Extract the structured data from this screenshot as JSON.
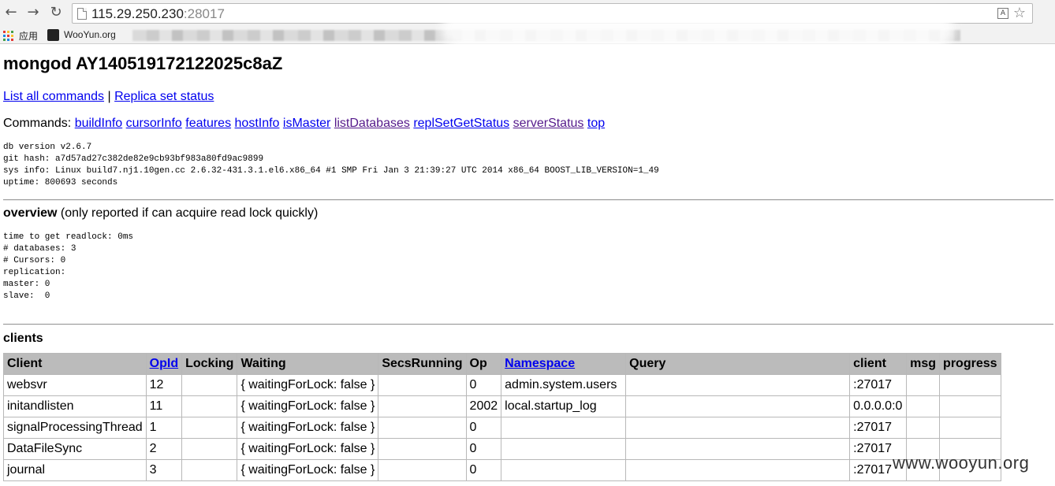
{
  "browser": {
    "url_host": "115.29.250.230",
    "url_port": ":28017",
    "bookmarks": [
      {
        "label": "应用"
      },
      {
        "label": "WooYun.org"
      }
    ]
  },
  "page": {
    "title": "mongod AY140519172122025c8aZ",
    "links": {
      "list_all_commands": "List all commands",
      "separator": " | ",
      "replica_set_status": "Replica set status"
    },
    "commands_label": "Commands:",
    "commands": [
      {
        "label": "buildInfo",
        "visited": false
      },
      {
        "label": "cursorInfo",
        "visited": false
      },
      {
        "label": "features",
        "visited": false
      },
      {
        "label": "hostInfo",
        "visited": false
      },
      {
        "label": "isMaster",
        "visited": false
      },
      {
        "label": "listDatabases",
        "visited": true
      },
      {
        "label": "replSetGetStatus",
        "visited": false
      },
      {
        "label": "serverStatus",
        "visited": true
      },
      {
        "label": "top",
        "visited": false
      }
    ],
    "version_info": "db version v2.6.7\ngit hash: a7d57ad27c382de82e9cb93bf983a80fd9ac9899\nsys info: Linux build7.nj1.10gen.cc 2.6.32-431.3.1.el6.x86_64 #1 SMP Fri Jan 3 21:39:27 UTC 2014 x86_64 BOOST_LIB_VERSION=1_49\nuptime: 800693 seconds",
    "overview": {
      "heading": "overview",
      "note": " (only reported if can acquire read lock quickly)",
      "details": "time to get readlock: 0ms\n# databases: 3\n# Cursors: 0\nreplication:\nmaster: 0\nslave:  0"
    },
    "clients_heading": "clients",
    "clients_table": {
      "columns": [
        {
          "label": "Client",
          "link": false
        },
        {
          "label": "OpId",
          "link": true
        },
        {
          "label": "Locking",
          "link": false
        },
        {
          "label": "Waiting",
          "link": false
        },
        {
          "label": "SecsRunning",
          "link": false
        },
        {
          "label": "Op",
          "link": false
        },
        {
          "label": "Namespace",
          "link": true
        },
        {
          "label": "Query",
          "link": false
        },
        {
          "label": "client",
          "link": false
        },
        {
          "label": "msg",
          "link": false
        },
        {
          "label": "progress",
          "link": false
        }
      ],
      "rows": [
        [
          "websvr",
          "12",
          "",
          "{ waitingForLock: false }",
          "",
          "0",
          "admin.system.users",
          "",
          ":27017",
          "",
          ""
        ],
        [
          "initandlisten",
          "11",
          "",
          "{ waitingForLock: false }",
          "",
          "2002",
          "local.startup_log",
          "",
          "0.0.0.0:0",
          "",
          ""
        ],
        [
          "signalProcessingThread",
          "1",
          "",
          "{ waitingForLock: false }",
          "",
          "0",
          "",
          "",
          ":27017",
          "",
          ""
        ],
        [
          "DataFileSync",
          "2",
          "",
          "{ waitingForLock: false }",
          "",
          "0",
          "",
          "",
          ":27017",
          "",
          ""
        ],
        [
          "journal",
          "3",
          "",
          "{ waitingForLock: false }",
          "",
          "0",
          "",
          "",
          ":27017",
          "",
          ""
        ]
      ]
    },
    "watermark": "www.wooyun.org"
  }
}
